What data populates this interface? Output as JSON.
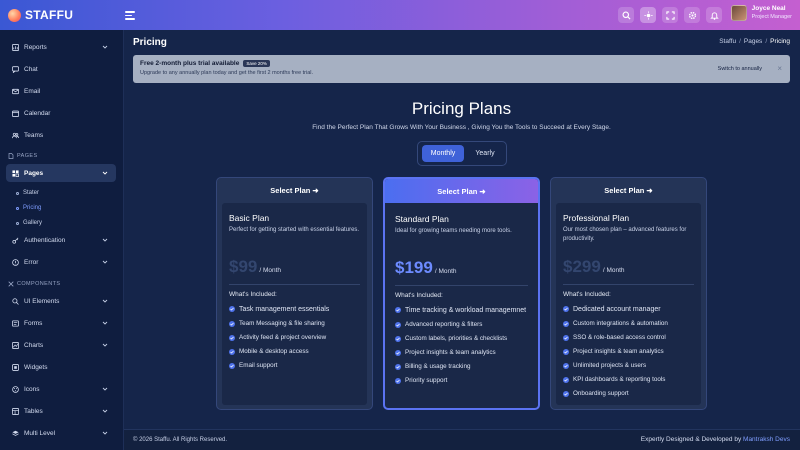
{
  "header": {
    "brand": "STAFFU",
    "user": {
      "name": "Joyce Neal",
      "role": "Project Manager"
    },
    "actions": [
      "search-icon",
      "sun-icon",
      "fullscreen-icon",
      "gear-icon",
      "bell-icon"
    ]
  },
  "sidebar": {
    "items": [
      {
        "label": "Reports",
        "icon": "chart-icon"
      },
      {
        "label": "Chat",
        "icon": "chat-icon"
      },
      {
        "label": "Email",
        "icon": "mail-icon"
      },
      {
        "label": "Calendar",
        "icon": "calendar-icon"
      },
      {
        "label": "Teams",
        "icon": "users-icon"
      }
    ],
    "section_pages": "PAGES",
    "pages": {
      "label": "Pages",
      "sub": [
        "Stater",
        "Pricing",
        "Gallery"
      ]
    },
    "authentication": "Authentication",
    "error": "Error",
    "section_components": "COMPONENTS",
    "components": [
      "UI Elements",
      "Forms",
      "Charts",
      "Widgets",
      "Icons",
      "Tables",
      "Multi Level"
    ]
  },
  "page": {
    "title": "Pricing",
    "breadcrumb": [
      "Staffu",
      "Pages",
      "Pricing"
    ]
  },
  "promo": {
    "title": "Free 2-month plus trial available",
    "badge": "Save 20%",
    "subtitle": "Upgrade to any annually plan today and get the first 2 months free trial.",
    "action": "Switch to annually",
    "close": "×"
  },
  "pricing": {
    "title": "Pricing Plans",
    "subtitle": "Find the Perfect Plan That Grows With Your Business , Giving You the Tools to Succeed at Every Stage.",
    "toggle": {
      "monthly": "Monthly",
      "yearly": "Yearly",
      "selected": "Monthly"
    },
    "plans": [
      {
        "select": "Select Plan ➜",
        "name": "Basic Plan",
        "desc": "Perfect for getting started with essential features.",
        "price": "$99",
        "unit": "/ Month",
        "included": "What's Included:",
        "features": [
          "Task management essentials",
          "Team Messaging & file sharing",
          "Activity feed & project overview",
          "Mobile & desktop access",
          "Email support"
        ]
      },
      {
        "select": "Select Plan ➜",
        "name": "Standard Plan",
        "desc": "Ideal for growing teams needing more tools.",
        "price": "$199",
        "unit": "/ Month",
        "included": "What's Included:",
        "features": [
          "Time tracking & workload managemnet",
          "Advanced reporting & filters",
          "Custom labels, priorities & checklists",
          "Project insights & team analytics",
          "Billing & usage tracking",
          "Priority support"
        ]
      },
      {
        "select": "Select Plan ➜",
        "name": "Professional Plan",
        "desc": "Our most chosen plan – advanced features for productivity.",
        "price": "$299",
        "unit": "/ Month",
        "included": "What's Included:",
        "features": [
          "Dedicated account manager",
          "Custom integrations & automation",
          "SSO & role-based access control",
          "Project insights & team analytics",
          "Unlimited projects & users",
          "KPI dashboards & reporting tools",
          "Onboarding support"
        ]
      }
    ]
  },
  "footer": {
    "copyright": "© 2026 Staffu. All Rights Reserved.",
    "credit_text": "Expertly Designed & Developed by",
    "credit_link": "Mantraksh Devs"
  }
}
